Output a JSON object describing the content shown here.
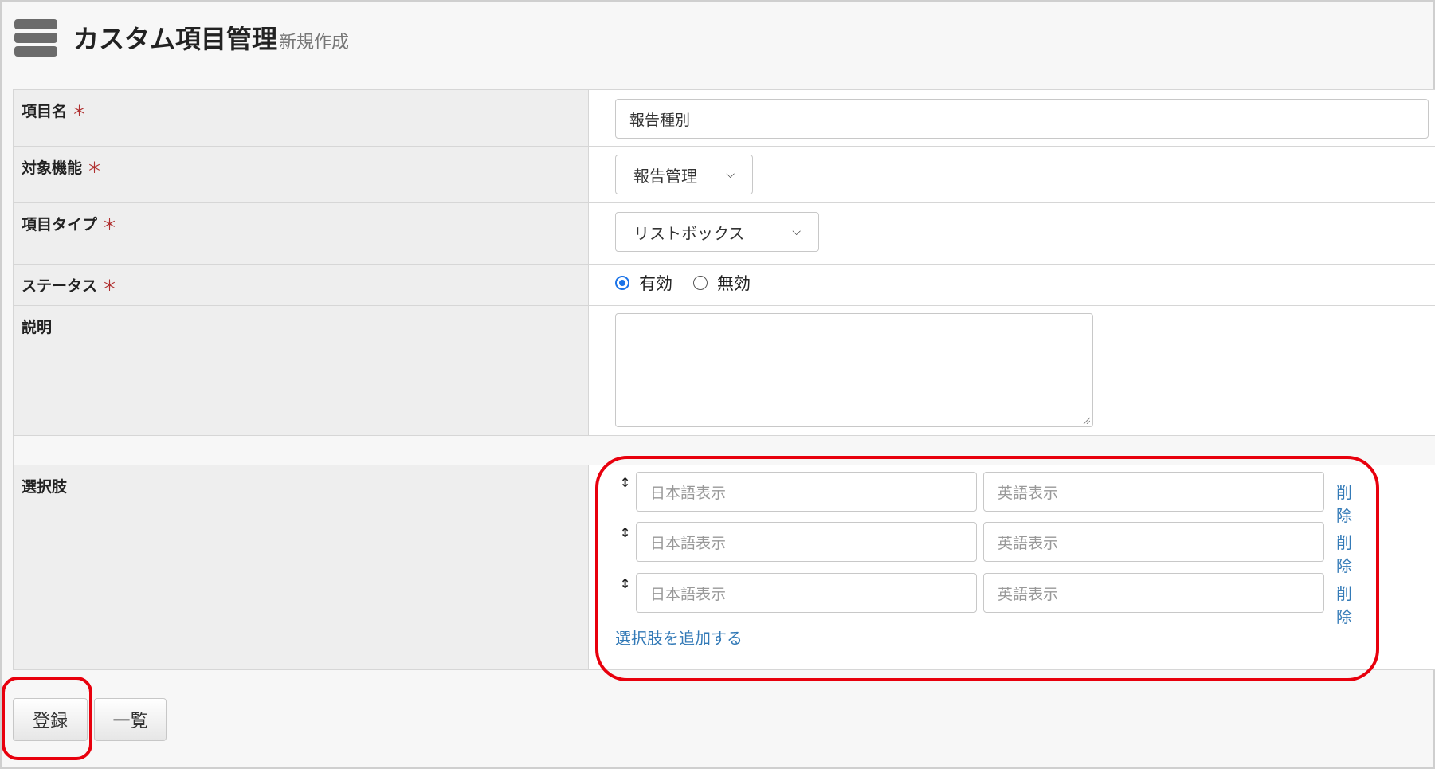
{
  "header": {
    "title": "カスタム項目管理",
    "subtitle": "新規作成",
    "icon": "database-icon"
  },
  "form": {
    "required_mark": "＊",
    "item_name": {
      "label": "項目名",
      "value": "報告種別"
    },
    "target_feature": {
      "label": "対象機能",
      "selected": "報告管理"
    },
    "item_type": {
      "label": "項目タイプ",
      "selected": "リストボックス"
    },
    "status": {
      "label": "ステータス",
      "options": [
        "有効",
        "無効"
      ],
      "selected": "有効"
    },
    "description": {
      "label": "説明",
      "value": ""
    },
    "choices": {
      "label": "選択肢",
      "rows": [
        {
          "ja_placeholder": "日本語表示",
          "en_placeholder": "英語表示",
          "delete_label": "削除"
        },
        {
          "ja_placeholder": "日本語表示",
          "en_placeholder": "英語表示",
          "delete_label": "削除"
        },
        {
          "ja_placeholder": "日本語表示",
          "en_placeholder": "英語表示",
          "delete_label": "削除"
        }
      ],
      "add_label": "選択肢を追加する"
    }
  },
  "buttons": {
    "register": "登録",
    "list": "一覧"
  },
  "colors": {
    "highlight": "#e8000d",
    "link": "#337ab7",
    "radio_accent": "#1a73e8",
    "required": "#b03030"
  }
}
